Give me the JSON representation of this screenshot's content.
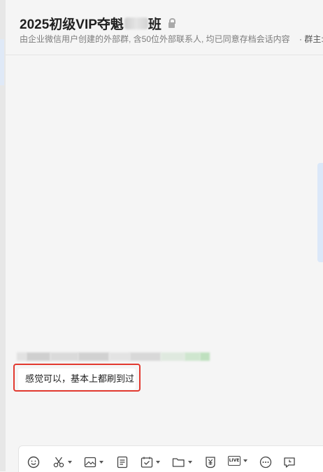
{
  "header": {
    "title_prefix": "2025初级VIP夺魁",
    "title_suffix": "班",
    "subtitle": "由企业微信用户创建的外部群, 含50位外部联系人, 均已同意存档会话内容",
    "group_owner_label": "· 群主:"
  },
  "messages": [
    {
      "text": "感觉可以，基本上都刷到过",
      "highlighted": true
    }
  ],
  "toolbar": {
    "tools": [
      "emoji-icon",
      "screenshot-scissors-icon",
      "image-icon",
      "document-icon",
      "todo-icon",
      "folder-icon",
      "payment-yen-icon",
      "live-icon",
      "more-icon",
      "chat-record-icon"
    ],
    "live_label": "LIVE"
  },
  "colors": {
    "highlight_border": "#e2392f",
    "background": "#f5f5f5",
    "bubble": "#ffffff"
  }
}
